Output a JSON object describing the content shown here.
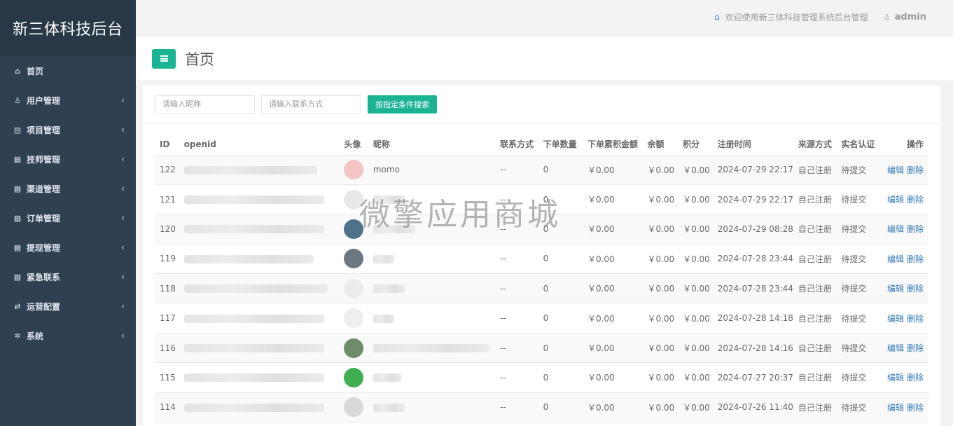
{
  "app": {
    "title": "新三体科技后台"
  },
  "sidebar": {
    "items": [
      {
        "label": "首页",
        "icon": "home-icon",
        "glyph": "⌂",
        "arrow": false
      },
      {
        "label": "用户管理",
        "icon": "user-icon",
        "glyph": "♙",
        "arrow": true
      },
      {
        "label": "项目管理",
        "icon": "list-icon",
        "glyph": "▤",
        "arrow": true
      },
      {
        "label": "技师管理",
        "icon": "grid-icon",
        "glyph": "▦",
        "arrow": true
      },
      {
        "label": "渠道管理",
        "icon": "grid-icon",
        "glyph": "▦",
        "arrow": true
      },
      {
        "label": "订单管理",
        "icon": "grid-icon",
        "glyph": "▦",
        "arrow": true
      },
      {
        "label": "提现管理",
        "icon": "grid-icon",
        "glyph": "▦",
        "arrow": true
      },
      {
        "label": "紧急联系",
        "icon": "grid-icon",
        "glyph": "▦",
        "arrow": true
      },
      {
        "label": "运营配置",
        "icon": "exchange-icon",
        "glyph": "⇄",
        "arrow": true
      },
      {
        "label": "系统",
        "icon": "gear-icon",
        "glyph": "✲",
        "arrow": true
      }
    ]
  },
  "topbar": {
    "welcome": "欢迎使用新三体科技管理系统后台管理",
    "user": "admin"
  },
  "page": {
    "title": "首页"
  },
  "search": {
    "nickname_placeholder": "请输入昵称",
    "contact_placeholder": "请输入联系方式",
    "button": "按指定条件搜索"
  },
  "table": {
    "headers": [
      "ID",
      "openid",
      "头像",
      "昵称",
      "联系方式",
      "下单数量",
      "下单累积金额",
      "余额",
      "积分",
      "注册时间",
      "来源方式",
      "实名认证",
      "操作"
    ],
    "edit_label": "编辑",
    "delete_label": "删除",
    "rows": [
      {
        "id": "122",
        "nickname": "momo",
        "contact": "--",
        "orders": "0",
        "amount": "￥0.00",
        "balance": "￥0.00",
        "points": "￥0.00",
        "time": "2024-07-29 22:17",
        "source": "自己注册",
        "verify": "待提交",
        "avatar_color": "#f3c4c4"
      },
      {
        "id": "121",
        "nickname": "",
        "contact": "--",
        "orders": "0",
        "amount": "￥0.00",
        "balance": "￥0.00",
        "points": "￥0.00",
        "time": "2024-07-29 22:17",
        "source": "自己注册",
        "verify": "待提交",
        "avatar_color": "#e8e8e8"
      },
      {
        "id": "120",
        "nickname": "",
        "contact": "--",
        "orders": "0",
        "amount": "￥0.00",
        "balance": "￥0.00",
        "points": "￥0.00",
        "time": "2024-07-29 08:28",
        "source": "自己注册",
        "verify": "待提交",
        "avatar_color": "#4d7289"
      },
      {
        "id": "119",
        "nickname": "",
        "contact": "--",
        "orders": "0",
        "amount": "￥0.00",
        "balance": "￥0.00",
        "points": "￥0.00",
        "time": "2024-07-28 23:44",
        "source": "自己注册",
        "verify": "待提交",
        "avatar_color": "#6b7781"
      },
      {
        "id": "118",
        "nickname": "",
        "contact": "--",
        "orders": "0",
        "amount": "￥0.00",
        "balance": "￥0.00",
        "points": "￥0.00",
        "time": "2024-07-28 23:44",
        "source": "自己注册",
        "verify": "待提交",
        "avatar_color": "#ececec"
      },
      {
        "id": "117",
        "nickname": "",
        "contact": "--",
        "orders": "0",
        "amount": "￥0.00",
        "balance": "￥0.00",
        "points": "￥0.00",
        "time": "2024-07-28 14:18",
        "source": "自己注册",
        "verify": "待提交",
        "avatar_color": "#eeeeee"
      },
      {
        "id": "116",
        "nickname": "",
        "contact": "--",
        "orders": "0",
        "amount": "￥0.00",
        "balance": "￥0.00",
        "points": "￥0.00",
        "time": "2024-07-28 14:16",
        "source": "自己注册",
        "verify": "待提交",
        "avatar_color": "#6e8c6a"
      },
      {
        "id": "115",
        "nickname": "",
        "contact": "--",
        "orders": "0",
        "amount": "￥0.00",
        "balance": "￥0.00",
        "points": "￥0.00",
        "time": "2024-07-27 20:37",
        "source": "自己注册",
        "verify": "待提交",
        "avatar_color": "#3fae4e"
      },
      {
        "id": "114",
        "nickname": "",
        "contact": "--",
        "orders": "0",
        "amount": "￥0.00",
        "balance": "￥0.00",
        "points": "￥0.00",
        "time": "2024-07-26 11:40",
        "source": "自己注册",
        "verify": "待提交",
        "avatar_color": "#d9d9d9"
      }
    ]
  },
  "watermark": "微擎应用商城"
}
